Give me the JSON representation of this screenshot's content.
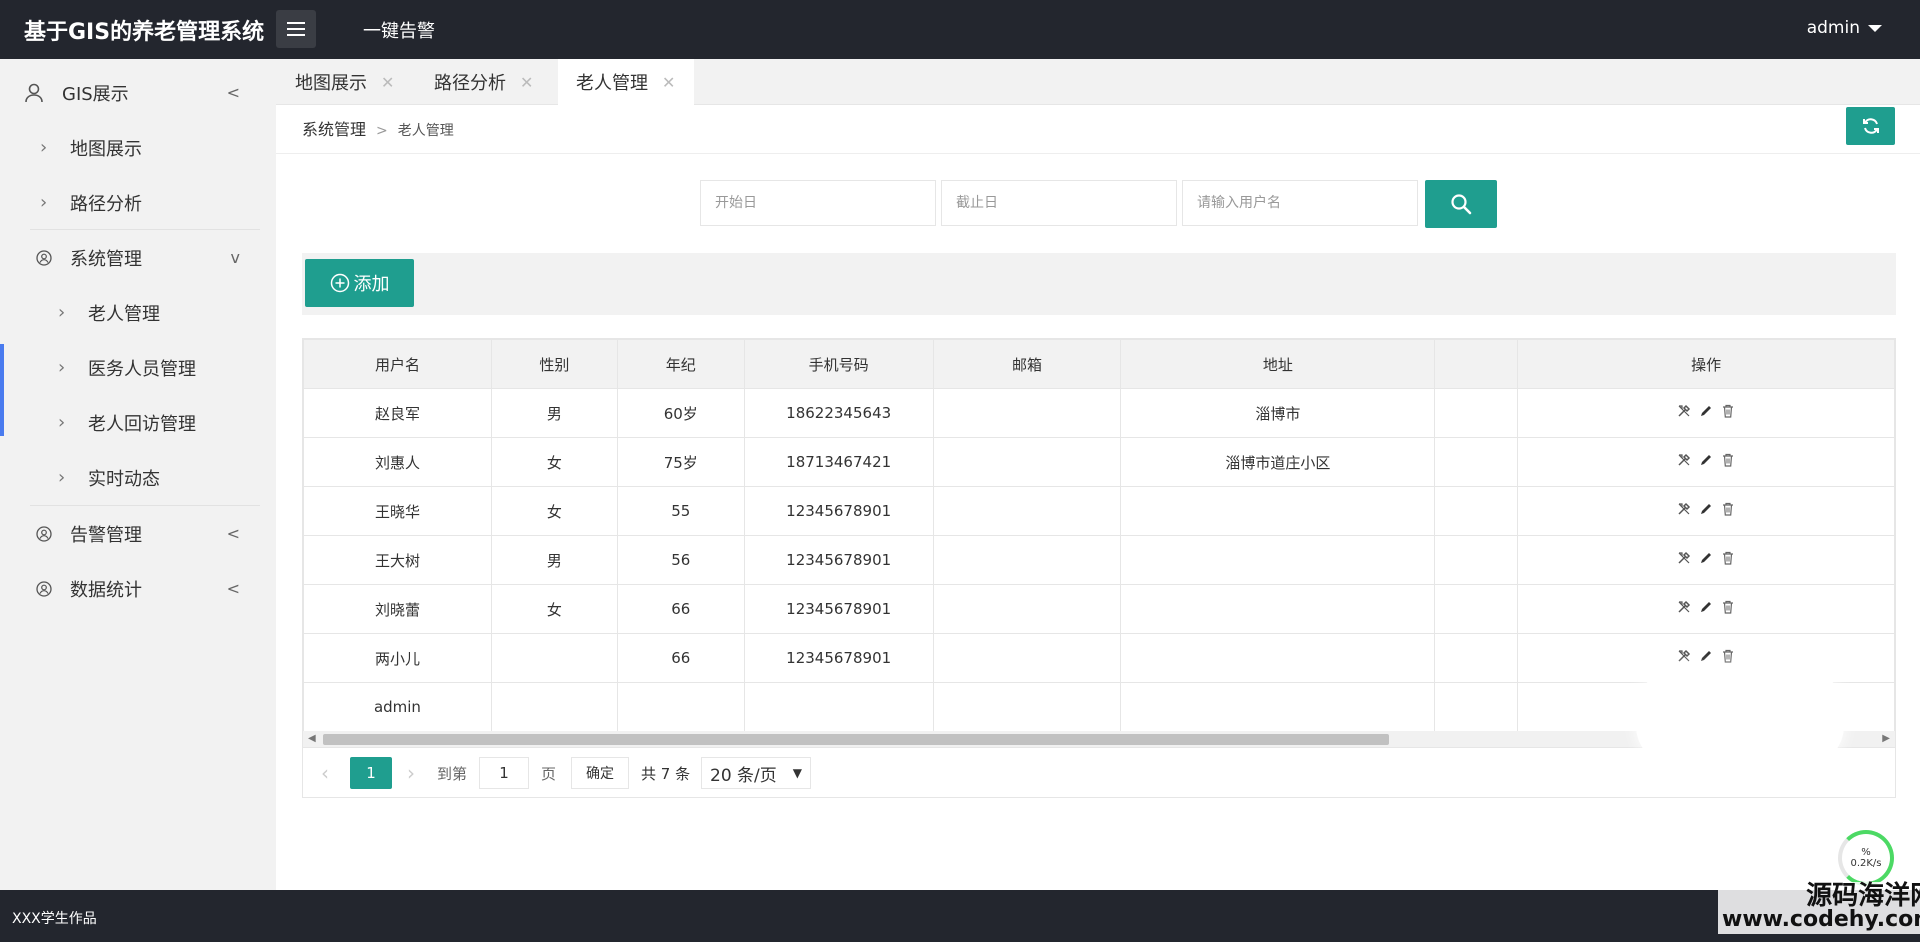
{
  "header": {
    "app_title": "基于GIS的养老管理系统",
    "alarm_link": "一键告警",
    "user": "admin"
  },
  "sidebar": {
    "items": [
      {
        "label": "GIS展示",
        "icon": "user-icon",
        "arrow": "<"
      },
      {
        "label": "地图展示",
        "icon": "chevron-right-icon"
      },
      {
        "label": "路径分析",
        "icon": "chevron-right-icon"
      },
      {
        "label": "系统管理",
        "icon": "user-circle-icon",
        "arrow": "v"
      },
      {
        "label": "老人管理",
        "icon": "chevron-right-icon"
      },
      {
        "label": "医务人员管理",
        "icon": "chevron-right-icon"
      },
      {
        "label": "老人回访管理",
        "icon": "chevron-right-icon"
      },
      {
        "label": "实时动态",
        "icon": "chevron-right-icon"
      },
      {
        "label": "告警管理",
        "icon": "user-circle-icon",
        "arrow": "<"
      },
      {
        "label": "数据统计",
        "icon": "user-circle-icon",
        "arrow": "<"
      }
    ]
  },
  "tabs": [
    {
      "label": "地图展示"
    },
    {
      "label": "路径分析"
    },
    {
      "label": "老人管理",
      "active": true
    }
  ],
  "breadcrumb": {
    "parent": "系统管理",
    "separator": ">",
    "current": "老人管理"
  },
  "search": {
    "start_placeholder": "开始日",
    "end_placeholder": "截止日",
    "user_placeholder": "请输入用户名"
  },
  "toolbar": {
    "add_label": "添加"
  },
  "table": {
    "columns": [
      "用户名",
      "性别",
      "年纪",
      "手机号码",
      "邮箱",
      "地址",
      "",
      "操作"
    ],
    "rows": [
      {
        "username": "赵良军",
        "gender": "男",
        "age": "60岁",
        "phone": "18622345643",
        "email": "",
        "address": "淄博市"
      },
      {
        "username": "刘惠人",
        "gender": "女",
        "age": "75岁",
        "phone": "18713467421",
        "email": "",
        "address": "淄博市道庄小区"
      },
      {
        "username": "王晓华",
        "gender": "女",
        "age": "55",
        "phone": "12345678901",
        "email": "",
        "address": ""
      },
      {
        "username": "王大树",
        "gender": "男",
        "age": "56",
        "phone": "12345678901",
        "email": "",
        "address": ""
      },
      {
        "username": "刘晓蕾",
        "gender": "女",
        "age": "66",
        "phone": "12345678901",
        "email": "",
        "address": ""
      },
      {
        "username": "两小儿",
        "gender": "",
        "age": "66",
        "phone": "12345678901",
        "email": "",
        "address": ""
      },
      {
        "username": "admin",
        "gender": "",
        "age": "",
        "phone": "",
        "email": "",
        "address": ""
      }
    ]
  },
  "pagination": {
    "current_page": "1",
    "goto_label": "到第",
    "goto_value": "1",
    "page_unit": "页",
    "confirm_label": "确定",
    "total": "共 7 条",
    "page_size": "20 条/页"
  },
  "footer": {
    "text": "XXX学生作品"
  },
  "watermark": {
    "name": "源码海洋网",
    "url": "www.codehy.com"
  },
  "net_widget": {
    "percent": "%",
    "speed": "0.2K/s"
  },
  "colors": {
    "header_bg": "#23262e",
    "accent": "#1f9e8f",
    "sidebar_bg": "#f2f2f2",
    "active_indicator": "#4a7bef"
  }
}
